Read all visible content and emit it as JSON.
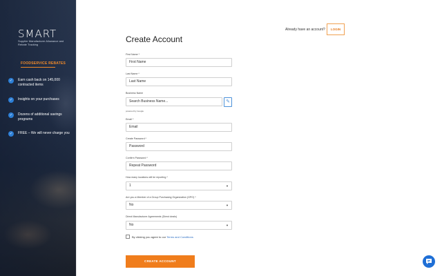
{
  "hero": {
    "logo": "SMART",
    "logo_subtitle": "Supplier Manufacturer Allowance and Rebate Tracking",
    "rebates_heading": "FOODSERVICE REBATES",
    "features": [
      {
        "text": "Earn cash back on 145,000 contracted items",
        "icon": "check-icon"
      },
      {
        "text": "Insights on your purchases",
        "icon": "check-icon"
      },
      {
        "text": "Dozens of additional savings programs",
        "icon": "check-icon"
      },
      {
        "text": "FREE – We will never charge you",
        "icon": "check-icon"
      }
    ],
    "accent_color": "#f08a2a"
  },
  "header": {
    "have_account": "Already have an account?",
    "login_label": "LOGIN"
  },
  "form": {
    "title": "Create Account",
    "first_name": {
      "label": "First Name *",
      "placeholder": "First Name"
    },
    "last_name": {
      "label": "Last Name *",
      "placeholder": "Last Name"
    },
    "business_name": {
      "label": "Business Name",
      "placeholder": "Search Business Name...",
      "powered_by": "powered by Google"
    },
    "email": {
      "label": "Email *",
      "placeholder": "Email"
    },
    "password": {
      "label": "Create Password *",
      "placeholder": "Password"
    },
    "confirm_password": {
      "label": "Confirm Password *",
      "placeholder": "Repeat Password"
    },
    "locations": {
      "label": "How many locations will be reporting *",
      "value": "1"
    },
    "gpo": {
      "label": "Are you a Member of a Group Purchasing Organization (GPO) *",
      "value": "No"
    },
    "dma": {
      "label": "Direct Manufacturer Agreements (Direct deals)",
      "value": "No"
    },
    "agree_prefix": "By clicking you agree to our",
    "terms_label": "Terms and Conditions",
    "submit_label": "CREATE ACCOUNT",
    "button_color": "#f07d1c"
  },
  "chat": {
    "icon": "chat-icon",
    "color": "#1f6fd6"
  }
}
